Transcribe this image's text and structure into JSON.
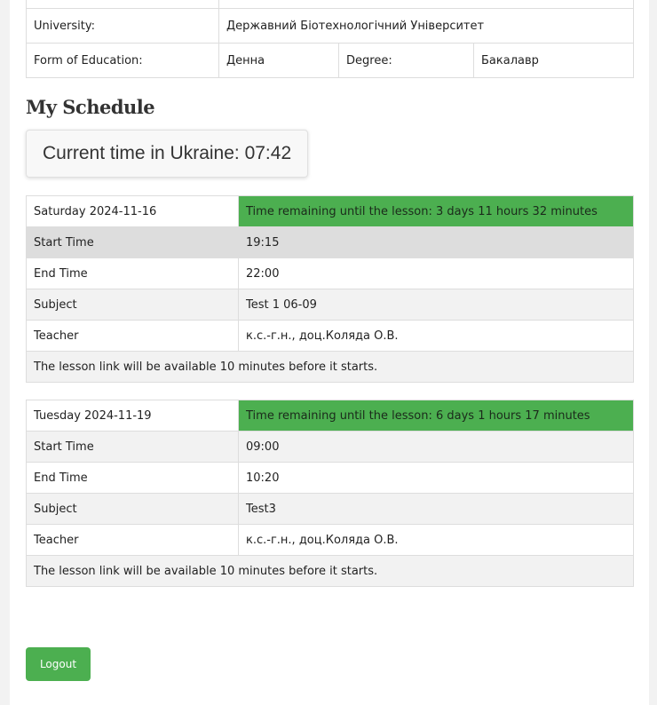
{
  "info": {
    "university_label": "University:",
    "university_value": "Державний Біотехнологічний Університет",
    "form_label": "Form of Education:",
    "form_value": "Денна",
    "degree_label": "Degree:",
    "degree_value": "Бакалавр"
  },
  "schedule_title": "My Schedule",
  "clock": {
    "label": "Current time in Ukraine: 07:42"
  },
  "lessons": [
    {
      "date": "Saturday 2024-11-16",
      "remaining": "Time remaining until the lesson: 3 days 11 hours 32 minutes",
      "start_label": "Start Time",
      "start_value": "19:15",
      "end_label": "End Time",
      "end_value": "22:00",
      "subject_label": "Subject",
      "subject_value": "Test 1 06-09",
      "teacher_label": "Teacher",
      "teacher_value": "к.с.-г.н., доц.Коляда О.В.",
      "link_note": "The lesson link will be available 10 minutes before it starts."
    },
    {
      "date": "Tuesday 2024-11-19",
      "remaining": "Time remaining until the lesson: 6 days 1 hours 17 minutes",
      "start_label": "Start Time",
      "start_value": "09:00",
      "end_label": "End Time",
      "end_value": "10:20",
      "subject_label": "Subject",
      "subject_value": "Test3",
      "teacher_label": "Teacher",
      "teacher_value": "к.с.-г.н., доц.Коляда О.В.",
      "link_note": "The lesson link will be available 10 minutes before it starts."
    }
  ],
  "logout_label": "Logout",
  "colors": {
    "accent_green": "#4caf50",
    "row_shade": "#f2f2f2",
    "row_highlight": "#dddddd"
  }
}
